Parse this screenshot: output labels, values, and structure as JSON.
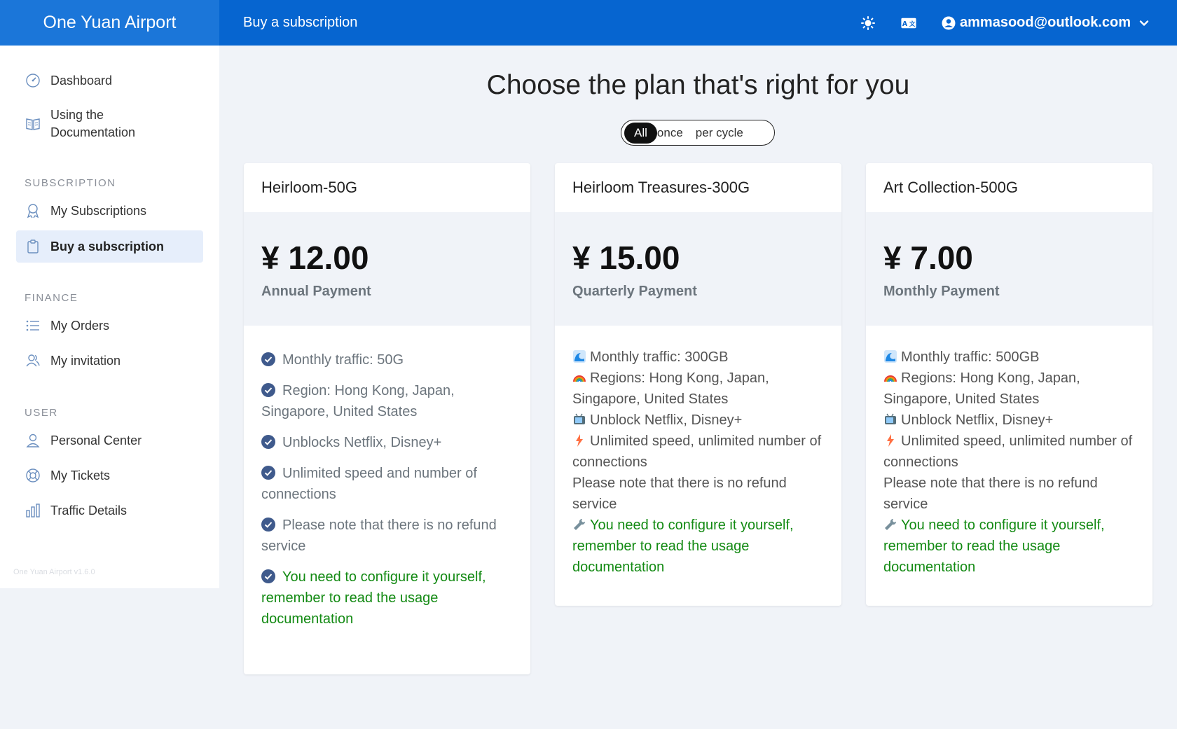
{
  "app": {
    "title": "One Yuan Airport",
    "version": "One Yuan Airport v1.6.0"
  },
  "header": {
    "page_title": "Buy a subscription",
    "user_email": "ammasood@outlook.com"
  },
  "sidebar": {
    "items": [
      {
        "label": "Dashboard",
        "icon": "dashboard-icon"
      },
      {
        "label": "Using the\nDocumentation",
        "icon": "book-icon"
      }
    ],
    "sections": [
      {
        "title": "SUBSCRIPTION",
        "items": [
          {
            "label": "My Subscriptions",
            "icon": "award-icon"
          },
          {
            "label": "Buy a subscription",
            "icon": "clipboard-icon",
            "active": true
          }
        ]
      },
      {
        "title": "FINANCE",
        "items": [
          {
            "label": "My Orders",
            "icon": "list-icon"
          },
          {
            "label": "My invitation",
            "icon": "users-icon"
          }
        ]
      },
      {
        "title": "USER",
        "items": [
          {
            "label": "Personal Center",
            "icon": "user-icon"
          },
          {
            "label": "My Tickets",
            "icon": "lifebuoy-icon"
          },
          {
            "label": "Traffic Details",
            "icon": "bar-chart-icon"
          }
        ]
      }
    ]
  },
  "main": {
    "title": "Choose the plan that's right for you",
    "cycle_options": [
      "All",
      "once",
      "per cycle"
    ],
    "selected_cycle": "All",
    "plans": [
      {
        "name": "Heirloom-50G",
        "price": "¥ 12.00",
        "period": "Annual Payment",
        "features": [
          "Monthly traffic: 50G",
          "Region: Hong Kong, Japan, Singapore, United States",
          "Unblocks Netflix, Disney+",
          "Unlimited speed and number of connections",
          "Please note that there is no refund service",
          "You need to configure it yourself, remember to read the usage documentation"
        ]
      },
      {
        "name": "Heirloom Treasures-300G",
        "price": "¥ 15.00",
        "period": "Quarterly Payment",
        "lines": [
          "Monthly traffic: 300GB",
          "Regions: Hong Kong, Japan, Singapore, United States",
          "Unblock Netflix, Disney+",
          "Unlimited speed, unlimited number of connections",
          "Please note that there is no refund service",
          "You need to configure it yourself, remember to read the usage documentation"
        ]
      },
      {
        "name": "Art Collection-500G",
        "price": "¥ 7.00",
        "period": "Monthly Payment",
        "lines": [
          "Monthly traffic: 500GB",
          "Regions: Hong Kong, Japan, Singapore, United States",
          "Unblock Netflix, Disney+",
          "Unlimited speed, unlimited number of connections",
          "Please note that there is no refund service",
          "You need to configure it yourself, remember to read the usage documentation"
        ]
      }
    ]
  },
  "colors": {
    "header_bg": "#0665d0",
    "brand_bg": "#1b76d9",
    "green_text": "#138a13",
    "active_nav": "#e6eefb"
  }
}
